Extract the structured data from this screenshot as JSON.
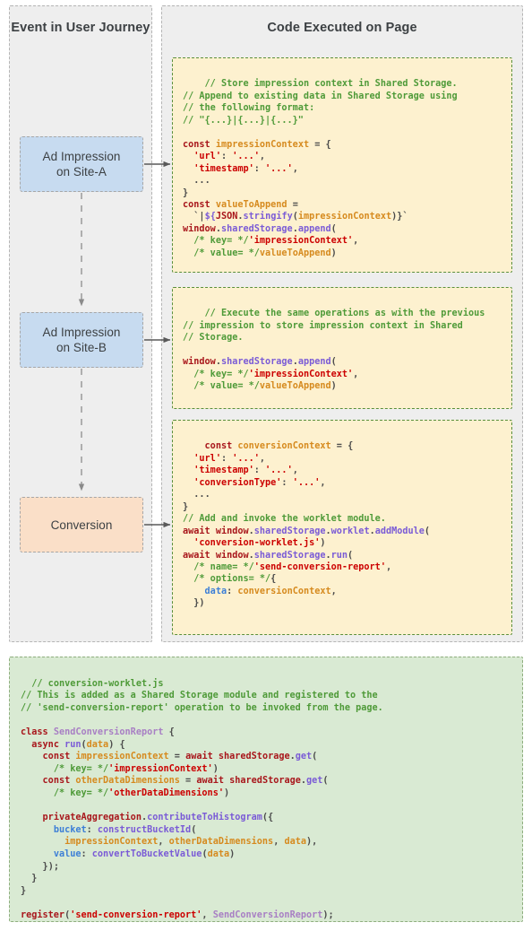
{
  "diagram": {
    "journey_panel": {
      "title": "Event in User Journey"
    },
    "code_panel": {
      "title": "Code Executed on Page"
    },
    "events": [
      {
        "label": "Ad Impression\non Site-A",
        "color": "#c7dbf0"
      },
      {
        "label": "Ad Impression\non Site-B",
        "color": "#c7dbf0"
      },
      {
        "label": "Conversion",
        "color": "#fadfc8"
      }
    ],
    "code_blocks": [
      {
        "name": "impression-site-a-code",
        "background": "#fdf1cf",
        "border": "#5a8f3c",
        "code": "// Store impression context in Shared Storage.\n// Append to existing data in Shared Storage using\n// the following format:\n// \"{...}|{...}|{...}\"\n\nconst impressionContext = {\n  'url': '...',\n  'timestamp': '...',\n  ...\n}\nconst valueToAppend =\n  `|${JSON.stringify(impressionContext)}`\nwindow.sharedStorage.append(\n  /* key= */'impressionContext',\n  /* value= */valueToAppend)"
      },
      {
        "name": "impression-site-b-code",
        "background": "#fdf1cf",
        "border": "#5a8f3c",
        "code": "// Execute the same operations as with the previous\n// impression to store impression context in Shared\n// Storage.\n\nwindow.sharedStorage.append(\n  /* key= */'impressionContext',\n  /* value= */valueToAppend)"
      },
      {
        "name": "conversion-code",
        "background": "#fdf1cf",
        "border": "#5a8f3c",
        "code": "const conversionContext = {\n  'url': '...',\n  'timestamp': '...',\n  'conversionType': '...',\n  ...\n}\n// Add and invoke the worklet module.\nawait window.sharedStorage.worklet.addModule(\n  'conversion-worklet.js')\nawait window.sharedStorage.run(\n  /* name= */'send-conversion-report',\n  /* options= */{\n    data: conversionContext,\n  })"
      }
    ],
    "worklet_block": {
      "name": "conversion-worklet-code",
      "background": "#d9ead3",
      "border": "#8fae7f",
      "code": "// conversion-worklet.js\n// This is added as a Shared Storage module and registered to the\n// 'send-conversion-report' operation to be invoked from the page.\n\nclass SendConversionReport {\n  async run(data) {\n    const impressionContext = await sharedStorage.get(\n      /* key= */'impressionContext')\n    const otherDataDimensions = await sharedStorage.get(\n      /* key= */'otherDataDimensions')\n\n    privateAggregation.contributeToHistogram({\n      bucket: constructBucketId(\n        impressionContext, otherDataDimensions, data),\n      value: convertToBucketValue(data)\n    });\n  }\n}\n\nregister('send-conversion-report', SendConversionReport);"
    },
    "connectors": [
      {
        "name": "event-0-to-event-1",
        "type": "vertical-dashed-arrow"
      },
      {
        "name": "event-1-to-event-2",
        "type": "vertical-dashed-arrow"
      },
      {
        "name": "event-0-to-code-0",
        "type": "horizontal-solid-arrow"
      },
      {
        "name": "event-1-to-code-1",
        "type": "horizontal-solid-arrow"
      },
      {
        "name": "event-2-to-code-2",
        "type": "horizontal-solid-arrow"
      }
    ]
  }
}
